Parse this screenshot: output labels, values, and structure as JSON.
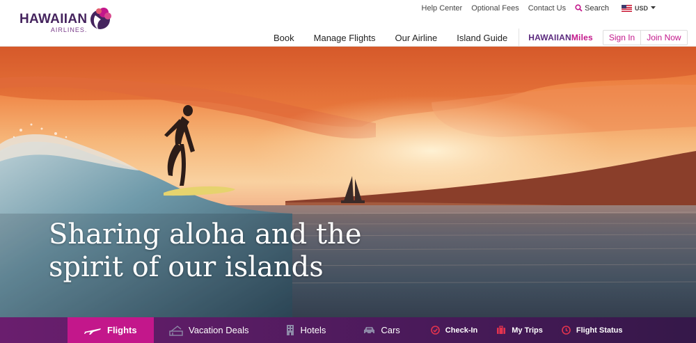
{
  "brand": {
    "name": "HAWAIIAN",
    "sub": "AIRLINES."
  },
  "utility_nav": {
    "help_center": "Help Center",
    "optional_fees": "Optional Fees",
    "contact_us": "Contact Us",
    "search": "Search",
    "currency": "USD"
  },
  "main_nav": {
    "items": [
      "Book",
      "Manage Flights",
      "Our Airline",
      "Island Guide"
    ],
    "miles_prefix": "HAWAIIAN",
    "miles_suffix": "Miles",
    "sign_in": "Sign In",
    "join_now": "Join Now"
  },
  "hero": {
    "headline_line1": "Sharing aloha and the",
    "headline_line2": "spirit of our islands"
  },
  "tabs": [
    {
      "label": "Flights",
      "icon": "plane-icon",
      "active": true
    },
    {
      "label": "Vacation Deals",
      "icon": "vacation-icon",
      "active": false
    },
    {
      "label": "Hotels",
      "icon": "hotel-icon",
      "active": false
    },
    {
      "label": "Cars",
      "icon": "car-icon",
      "active": false
    },
    {
      "label": "Check-In",
      "icon": "check-circle-icon",
      "active": false
    },
    {
      "label": "My Trips",
      "icon": "suitcase-icon",
      "active": false
    },
    {
      "label": "Flight Status",
      "icon": "clock-icon",
      "active": false
    }
  ],
  "colors": {
    "brand_purple": "#45245e",
    "accent_magenta": "#c3178b",
    "tab_bar": "#4a1a5a",
    "icon_red": "#e4344e"
  }
}
